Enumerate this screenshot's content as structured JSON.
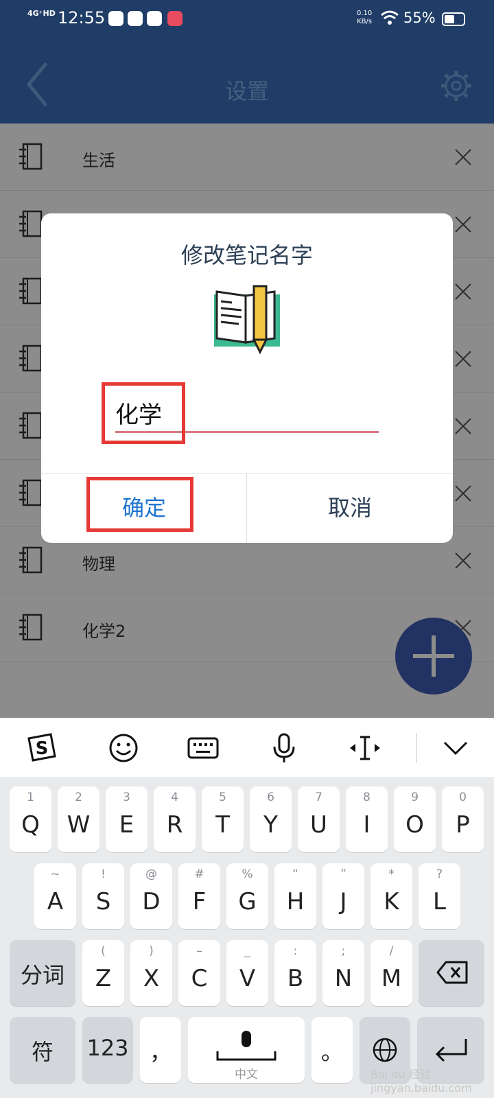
{
  "status_bar": {
    "network": "4G⁺HD",
    "time": "12:55",
    "speed_value": "0.10",
    "speed_unit": "KB/s",
    "battery": "55%"
  },
  "header": {
    "title": "设置",
    "back_icon": "chevron-left-icon",
    "settings_icon": "gear-icon"
  },
  "notebooks": [
    {
      "label": "生活"
    },
    {
      "label": ""
    },
    {
      "label": ""
    },
    {
      "label": ""
    },
    {
      "label": ""
    },
    {
      "label": ""
    },
    {
      "label": "物理"
    },
    {
      "label": "化学2"
    }
  ],
  "dialog": {
    "title": "修改笔记名字",
    "input_value": "化学",
    "confirm_label": "确定",
    "cancel_label": "取消"
  },
  "keyboard": {
    "row1": [
      {
        "hint": "1",
        "key": "Q"
      },
      {
        "hint": "2",
        "key": "W"
      },
      {
        "hint": "3",
        "key": "E"
      },
      {
        "hint": "4",
        "key": "R"
      },
      {
        "hint": "5",
        "key": "T"
      },
      {
        "hint": "6",
        "key": "Y"
      },
      {
        "hint": "7",
        "key": "U"
      },
      {
        "hint": "8",
        "key": "I"
      },
      {
        "hint": "9",
        "key": "O"
      },
      {
        "hint": "0",
        "key": "P"
      }
    ],
    "row2": [
      {
        "hint": "~",
        "key": "A"
      },
      {
        "hint": "!",
        "key": "S"
      },
      {
        "hint": "@",
        "key": "D"
      },
      {
        "hint": "#",
        "key": "F"
      },
      {
        "hint": "%",
        "key": "G"
      },
      {
        "hint": "“",
        "key": "H"
      },
      {
        "hint": "”",
        "key": "J"
      },
      {
        "hint": "*",
        "key": "K"
      },
      {
        "hint": "?",
        "key": "L"
      }
    ],
    "row3": [
      {
        "hint": "(",
        "key": "Z"
      },
      {
        "hint": ")",
        "key": "X"
      },
      {
        "hint": "–",
        "key": "C"
      },
      {
        "hint": "_",
        "key": "V"
      },
      {
        "hint": ":",
        "key": "B"
      },
      {
        "hint": ";",
        "key": "N"
      },
      {
        "hint": "/",
        "key": "M"
      }
    ],
    "segment_label": "分词",
    "symbol_label": "符",
    "number_label": "123",
    "comma": "，",
    "space_sub": "中文",
    "period": "。"
  },
  "watermark": "Bai du 经验 jingyan.baidu.com",
  "colors": {
    "header_bg": "#1f3d66",
    "fab": "#3c5cb5",
    "confirm": "#1f74d1",
    "highlight": "#e53a35",
    "input_underline": "#d97a7f"
  }
}
